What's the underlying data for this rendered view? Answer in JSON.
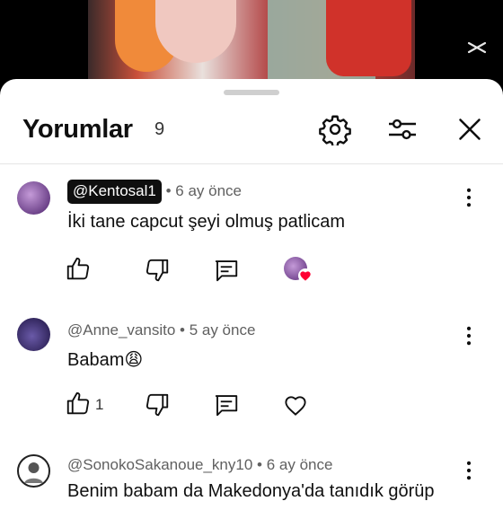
{
  "header": {
    "title": "Yorumlar",
    "count": "9",
    "icons": [
      "gear-icon",
      "filter-sliders-icon",
      "close-icon"
    ]
  },
  "comments": [
    {
      "handle": "@Kentosal1",
      "handle_highlighted": true,
      "time": "• 6 ay önce",
      "text": "İki tane capcut şeyi olmuş patlicam",
      "likes": "",
      "creator_heart": true
    },
    {
      "handle": "@Anne_vansito",
      "handle_highlighted": false,
      "time": "• 5 ay önce",
      "text": "Babam😩",
      "likes": "1",
      "creator_heart": false
    },
    {
      "handle": "@SonokoSakanoue_kny10",
      "handle_highlighted": false,
      "time": "• 6 ay önce",
      "text": "Benim babam da Makedonya'da tanıdık görüp",
      "likes": "",
      "creator_heart": false
    }
  ],
  "colors": {
    "sheet": "#ffffff",
    "heart": "#ff0033",
    "chip": "#0f0f0f"
  }
}
